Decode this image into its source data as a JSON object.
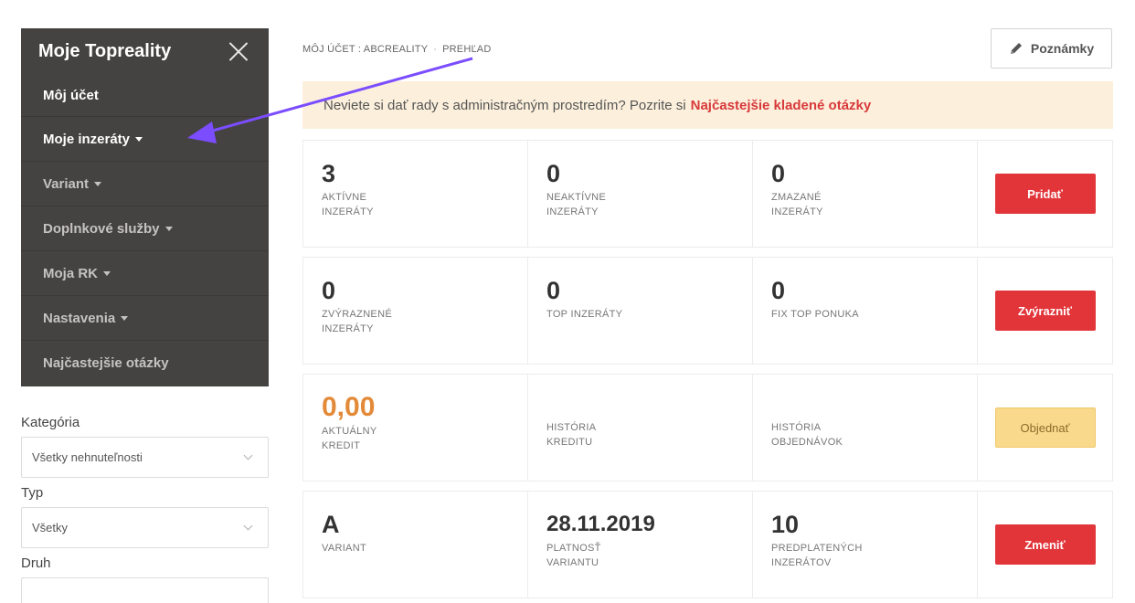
{
  "sidebar": {
    "title": "Moje Topreality",
    "items": [
      {
        "label": "Môj účet",
        "caret": false
      },
      {
        "label": "Moje inzeráty",
        "caret": true
      },
      {
        "label": "Variant",
        "caret": true
      },
      {
        "label": "Doplnkové služby",
        "caret": true
      },
      {
        "label": "Moja RK",
        "caret": true
      },
      {
        "label": "Nastavenia",
        "caret": true
      },
      {
        "label": "Najčastejšie otázky",
        "caret": false
      }
    ]
  },
  "filters": {
    "category_label": "Kategória",
    "category_value": "Všetky nehnuteľnosti",
    "type_label": "Typ",
    "type_value": "Všetky",
    "kind_label": "Druh",
    "kind_value": ""
  },
  "breadcrumb": {
    "account": "MÔJ ÚČET : ABCREALITY",
    "separator": "·",
    "current": "PREHĽAD"
  },
  "notes_button": "Poznámky",
  "alert": {
    "text": "Neviete si dať rady s administračným prostredím? Pozrite si",
    "link": "Najčastejšie kladené otázky"
  },
  "rows": [
    {
      "cells": [
        {
          "value": "3",
          "label1": "AKTÍVNE",
          "label2": "INZERÁTY"
        },
        {
          "value": "0",
          "label1": "NEAKTÍVNE",
          "label2": "INZERÁTY"
        },
        {
          "value": "0",
          "label1": "ZMAZANÉ",
          "label2": "INZERÁTY"
        }
      ],
      "button": "Pridať"
    },
    {
      "cells": [
        {
          "value": "0",
          "label1": "ZVÝRAZNENÉ",
          "label2": "INZERÁTY"
        },
        {
          "value": "0",
          "label1": "TOP INZERÁTY",
          "label2": ""
        },
        {
          "value": "0",
          "label1": "FIX TOP PONUKA",
          "label2": ""
        }
      ],
      "button": "Zvýrazniť"
    },
    {
      "cells": [
        {
          "value": "0,00",
          "label1": "AKTUÁLNY",
          "label2": "KREDIT"
        },
        {
          "value": "",
          "label1": "HISTÓRIA",
          "label2": "KREDITU"
        },
        {
          "value": "",
          "label1": "HISTÓRIA",
          "label2": "OBJEDNÁVOK"
        }
      ],
      "button": "Objednať"
    },
    {
      "cells": [
        {
          "value": "A",
          "label1": "VARIANT",
          "label2": ""
        },
        {
          "value": "28.11.2019",
          "label1": "PLATNOSŤ",
          "label2": "VARIANTU"
        },
        {
          "value": "10",
          "label1": "PREDPLATENÝCH",
          "label2": "INZERÁTOV"
        }
      ],
      "button": "Zmeniť"
    }
  ],
  "colors": {
    "sidebar_bg": "#454341",
    "accent_red": "#e2353a",
    "credit_orange": "#e38a39",
    "alert_bg": "#fcf0dc",
    "annotation_arrow": "#7b4dff"
  }
}
